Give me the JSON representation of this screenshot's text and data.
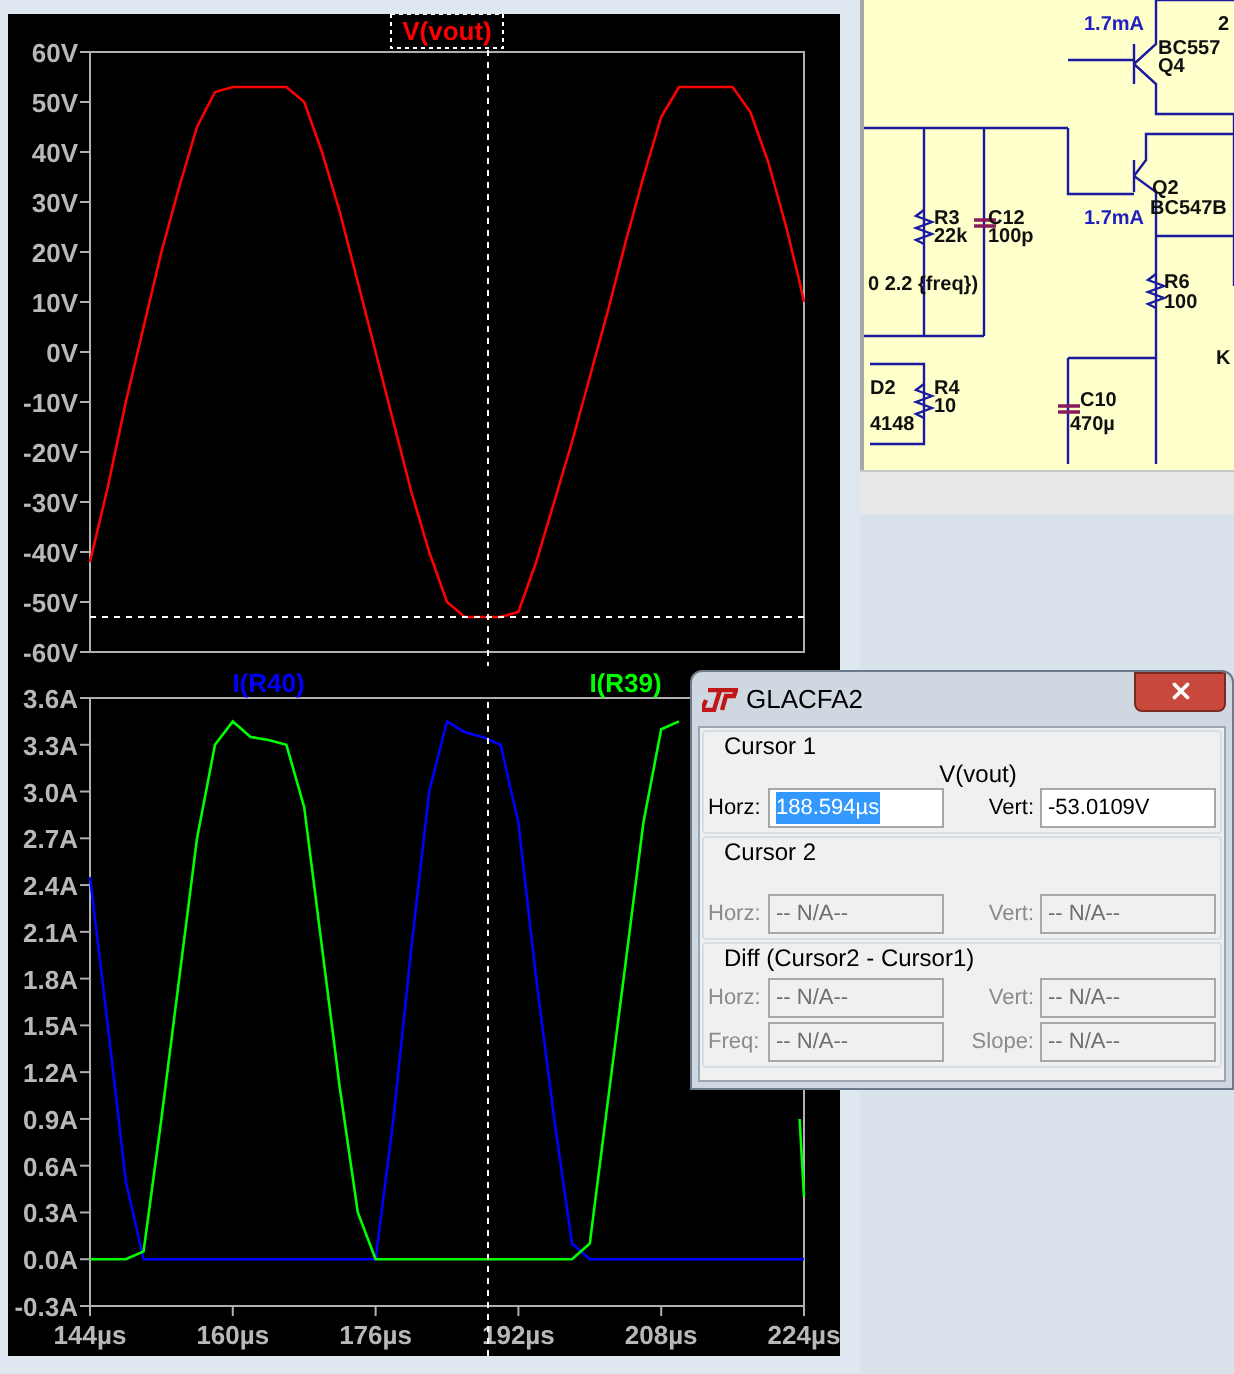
{
  "plot_window": {
    "panes": [
      {
        "first_title_selected": true,
        "chart_data": {
          "type": "line",
          "x": [
            144,
            146,
            148,
            150,
            152,
            154,
            156,
            158,
            160,
            162,
            164,
            166,
            168,
            170,
            172,
            174,
            176,
            178,
            180,
            182,
            184,
            186,
            188,
            190,
            192,
            194,
            196,
            198,
            200,
            202,
            204,
            206,
            208,
            210,
            212,
            214,
            216,
            218,
            220,
            222,
            223.5,
            224
          ],
          "xlim": [
            144,
            224
          ],
          "ylim": [
            -60,
            60
          ],
          "yticks": [
            {
              "value": 60,
              "label": "60V"
            },
            {
              "value": 50,
              "label": "50V"
            },
            {
              "value": 40,
              "label": "40V"
            },
            {
              "value": 30,
              "label": "30V"
            },
            {
              "value": 20,
              "label": "20V"
            },
            {
              "value": 10,
              "label": "10V"
            },
            {
              "value": 0,
              "label": "0V"
            },
            {
              "value": -10,
              "label": "-10V"
            },
            {
              "value": -20,
              "label": "-20V"
            },
            {
              "value": -30,
              "label": "-30V"
            },
            {
              "value": -40,
              "label": "-40V"
            },
            {
              "value": -50,
              "label": "-50V"
            },
            {
              "value": -60,
              "label": "-60V"
            }
          ],
          "series": [
            {
              "name": "V(vout)",
              "color": "#ff0000",
              "values": [
                -42,
                -27,
                -10,
                5,
                20,
                33,
                45,
                52,
                53,
                53,
                53,
                53,
                50,
                40,
                28,
                14,
                0,
                -14,
                -28,
                -40,
                -50,
                -53,
                -53,
                -53,
                -52,
                -42,
                -30,
                -18,
                -5,
                8,
                22,
                35,
                47,
                53,
                53,
                53,
                53,
                48,
                38,
                25,
                14,
                10
              ]
            }
          ],
          "ref_lines": [
            {
              "axis": "x",
              "value": 188.594
            },
            {
              "axis": "y",
              "value": -53.0109
            }
          ]
        }
      },
      {
        "first_title_selected": false,
        "chart_data": {
          "type": "line",
          "x": [
            144,
            146,
            148,
            150,
            152,
            154,
            156,
            158,
            160,
            162,
            164,
            166,
            168,
            170,
            172,
            174,
            176,
            178,
            180,
            182,
            184,
            186,
            188,
            190,
            192,
            194,
            196,
            198,
            200,
            202,
            204,
            206,
            208,
            210,
            212,
            214,
            216,
            218,
            220,
            222,
            223.5,
            224
          ],
          "xlim": [
            144,
            224
          ],
          "ylim": [
            -0.3,
            3.6
          ],
          "xticks": [
            {
              "value": 144,
              "label": "144µs"
            },
            {
              "value": 160,
              "label": "160µs"
            },
            {
              "value": 176,
              "label": "176µs"
            },
            {
              "value": 192,
              "label": "192µs"
            },
            {
              "value": 208,
              "label": "208µs"
            },
            {
              "value": 224,
              "label": "224µs"
            }
          ],
          "yticks": [
            {
              "value": 3.6,
              "label": "3.6A"
            },
            {
              "value": 3.3,
              "label": "3.3A"
            },
            {
              "value": 3.0,
              "label": "3.0A"
            },
            {
              "value": 2.7,
              "label": "2.7A"
            },
            {
              "value": 2.4,
              "label": "2.4A"
            },
            {
              "value": 2.1,
              "label": "2.1A"
            },
            {
              "value": 1.8,
              "label": "1.8A"
            },
            {
              "value": 1.5,
              "label": "1.5A"
            },
            {
              "value": 1.2,
              "label": "1.2A"
            },
            {
              "value": 0.9,
              "label": "0.9A"
            },
            {
              "value": 0.6,
              "label": "0.6A"
            },
            {
              "value": 0.3,
              "label": "0.3A"
            },
            {
              "value": 0,
              "label": "0.0A"
            },
            {
              "value": -0.3,
              "label": "-0.3A"
            }
          ],
          "series": [
            {
              "name": "I(R40)",
              "color": "#0000ff",
              "values": [
                2.45,
                1.5,
                0.5,
                0,
                0,
                0,
                0,
                0,
                0,
                0,
                0,
                0,
                0,
                0,
                0,
                0,
                0,
                0.9,
                2.0,
                3.0,
                3.45,
                3.38,
                3.35,
                3.3,
                2.8,
                1.8,
                0.9,
                0.1,
                0,
                0,
                0,
                0,
                0,
                0,
                0,
                0,
                0,
                0,
                0,
                0,
                0,
                0
              ]
            },
            {
              "name": "I(R39)",
              "color": "#00ff00",
              "values": [
                0,
                0,
                0,
                0.05,
                0.9,
                1.8,
                2.7,
                3.3,
                3.45,
                3.35,
                3.33,
                3.3,
                2.9,
                2.0,
                1.1,
                0.3,
                0,
                0,
                0,
                0,
                0,
                0,
                0,
                0,
                0,
                0,
                0,
                0,
                0.1,
                1.0,
                1.9,
                2.8,
                3.4,
                3.45,
                null,
                null,
                null,
                null,
                null,
                null,
                0.9,
                0.4
              ]
            }
          ],
          "ref_lines": [
            {
              "axis": "x",
              "value": 188.594
            }
          ]
        }
      }
    ]
  },
  "schematic": {
    "labels": [
      {
        "text": "1.7mA",
        "kind": "current"
      },
      {
        "text": "BC557",
        "kind": "part"
      },
      {
        "text": "Q4",
        "kind": "part"
      },
      {
        "text": "2",
        "kind": "part"
      },
      {
        "text": "Q2",
        "kind": "part"
      },
      {
        "text": "BC547B",
        "kind": "part"
      },
      {
        "text": "R3",
        "kind": "part"
      },
      {
        "text": "C12",
        "kind": "part"
      },
      {
        "text": "1.7mA",
        "kind": "current"
      },
      {
        "text": "22k",
        "kind": "part"
      },
      {
        "text": "100p",
        "kind": "part"
      },
      {
        "text": "0 2.2 {freq})",
        "kind": "part"
      },
      {
        "text": "R6",
        "kind": "part"
      },
      {
        "text": "100",
        "kind": "part"
      },
      {
        "text": "K",
        "kind": "part"
      },
      {
        "text": "D2",
        "kind": "part"
      },
      {
        "text": "R4",
        "kind": "part"
      },
      {
        "text": "10",
        "kind": "part"
      },
      {
        "text": "4148",
        "kind": "part"
      },
      {
        "text": "C10",
        "kind": "part"
      },
      {
        "text": "470µ",
        "kind": "part"
      }
    ]
  },
  "cursor_dialog": {
    "title": "GLACFA2",
    "groups": [
      {
        "label": "Cursor 1",
        "trace": "V(vout)",
        "fields": [
          {
            "label": "Horz:",
            "value": "188.594µs",
            "disabled": false,
            "selected": true
          },
          {
            "label": "Vert:",
            "value": "-53.0109V",
            "disabled": false,
            "selected": false
          }
        ]
      },
      {
        "label": "Cursor 2",
        "fields": [
          {
            "label": "Horz:",
            "value": "-- N/A--",
            "disabled": true,
            "selected": false
          },
          {
            "label": "Vert:",
            "value": "-- N/A--",
            "disabled": true,
            "selected": false
          }
        ]
      },
      {
        "label": "Diff (Cursor2 - Cursor1)",
        "fields": [
          {
            "label": "Horz:",
            "value": "-- N/A--",
            "disabled": true,
            "selected": false
          },
          {
            "label": "Vert:",
            "value": "-- N/A--",
            "disabled": true,
            "selected": false
          },
          {
            "label": "Freq:",
            "value": "-- N/A--",
            "disabled": true,
            "selected": false
          },
          {
            "label": "Slope:",
            "value": "-- N/A--",
            "disabled": true,
            "selected": false
          }
        ]
      }
    ]
  }
}
